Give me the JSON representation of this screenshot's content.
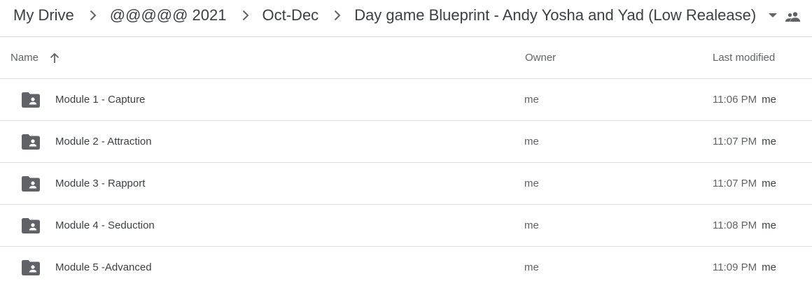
{
  "breadcrumb": {
    "items": [
      "My Drive",
      "@@@@@ 2021",
      "Oct-Dec",
      "Day game Blueprint - Andy Yosha and Yad (Low Realease)"
    ],
    "dropdown_icon": "arrow-drop-down-icon",
    "share_icon": "people-icon"
  },
  "table": {
    "headers": {
      "name": "Name",
      "owner": "Owner",
      "modified": "Last modified"
    },
    "sort_icon": "arrow-up-icon",
    "rows": [
      {
        "name": "Module 1 - Capture",
        "owner": "me",
        "modified": "11:06 PM",
        "modified_by": "me"
      },
      {
        "name": "Module 2 - Attraction",
        "owner": "me",
        "modified": "11:07 PM",
        "modified_by": "me"
      },
      {
        "name": "Module 3 - Rapport",
        "owner": "me",
        "modified": "11:07 PM",
        "modified_by": "me"
      },
      {
        "name": "Module 4 - Seduction",
        "owner": "me",
        "modified": "11:08 PM",
        "modified_by": "me"
      },
      {
        "name": "Module 5 -Advanced",
        "owner": "me",
        "modified": "11:09 PM",
        "modified_by": "me"
      }
    ],
    "row_icon": "shared-folder-icon"
  },
  "colors": {
    "text": "#3c4043",
    "secondary_text": "#5f6368",
    "icon": "#5f6368",
    "divider": "#e0e0e0"
  }
}
